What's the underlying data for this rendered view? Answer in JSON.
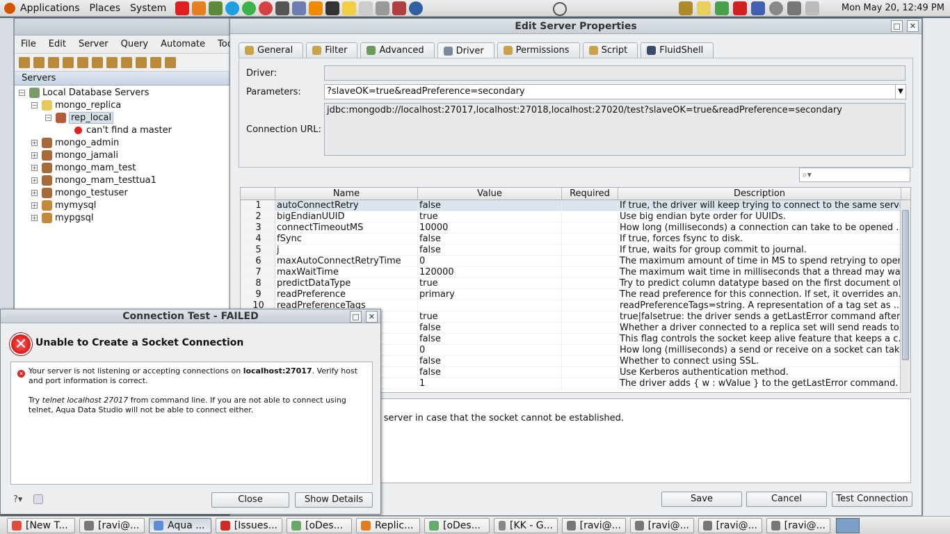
{
  "top_panel": {
    "menus": [
      "Applications",
      "Places",
      "System"
    ],
    "clock": "Mon May 20, 12:49 PM"
  },
  "main_window": {
    "menus": [
      "File",
      "Edit",
      "Server",
      "Query",
      "Automate",
      "Tools"
    ],
    "servers_header": "Servers",
    "tree": {
      "root": "Local Database Servers",
      "group": "mongo_replica",
      "selected": "rep_local",
      "error_node": "can't find a master",
      "servers": [
        "mongo_admin",
        "mongo_jamali",
        "mongo_mam_test",
        "mongo_mam_testtua1",
        "mongo_testuser",
        "mymysql",
        "mypgsql"
      ]
    }
  },
  "dialog": {
    "title": "Edit Server Properties",
    "tabs": [
      "General",
      "Filter",
      "Advanced",
      "Driver",
      "Permissions",
      "Script",
      "FluidShell"
    ],
    "active_tab": "Driver",
    "driver_label": "Driver:",
    "driver_value": "",
    "parameters_label": "Parameters:",
    "parameters_value": "?slaveOK=true&readPreference=secondary",
    "url_label": "Connection URL:",
    "url_value": "jdbc:mongodb://localhost:27017,localhost:27018,localhost:27020/test?slaveOK=true&readPreference=secondary",
    "columns": [
      "",
      "Name",
      "Value",
      "Required",
      "Description"
    ],
    "rows": [
      {
        "n": "1",
        "name": "autoConnectRetry",
        "value": "false",
        "req": "",
        "desc": "If true, the driver will keep trying to connect to the same serve..."
      },
      {
        "n": "2",
        "name": "bigEndianUUID",
        "value": "true",
        "req": "",
        "desc": "Use big endian byte order for UUIDs."
      },
      {
        "n": "3",
        "name": "connectTimeoutMS",
        "value": "10000",
        "req": "",
        "desc": "How long (milliseconds) a connection can take to be opened ..."
      },
      {
        "n": "4",
        "name": "fSync",
        "value": "false",
        "req": "",
        "desc": "If true, forces fsync to disk."
      },
      {
        "n": "5",
        "name": "j",
        "value": "false",
        "req": "",
        "desc": "If true, waits for group commit to journal."
      },
      {
        "n": "6",
        "name": "maxAutoConnectRetryTime",
        "value": "0",
        "req": "",
        "desc": "The maximum amount of time in MS to spend retrying to open ..."
      },
      {
        "n": "7",
        "name": "maxWaitTime",
        "value": "120000",
        "req": "",
        "desc": "The maximum wait time in milliseconds that a thread may wait ..."
      },
      {
        "n": "8",
        "name": "predictDataType",
        "value": "true",
        "req": "",
        "desc": "Try to predict column datatype based on the first document of..."
      },
      {
        "n": "9",
        "name": "readPreference",
        "value": "primary",
        "req": "",
        "desc": "The read preference for this connection. If set, it overrides an..."
      },
      {
        "n": "10",
        "name": "readPreferenceTags",
        "value": "",
        "req": "",
        "desc": "readPreferenceTags=string. A representation of a tag set as ..."
      },
      {
        "n": "",
        "name": "",
        "value": "true",
        "req": "",
        "desc": "true|falsetrue: the driver sends a getLastError command after..."
      },
      {
        "n": "",
        "name": "",
        "value": "false",
        "req": "",
        "desc": "Whether a driver connected to a replica set will send reads to..."
      },
      {
        "n": "",
        "name": "",
        "value": "false",
        "req": "",
        "desc": "This flag controls the socket keep alive feature that keeps a c..."
      },
      {
        "n": "",
        "name": "",
        "value": "0",
        "req": "",
        "desc": "How long (milliseconds) a send or receive on a socket can tak..."
      },
      {
        "n": "",
        "name": "",
        "value": "false",
        "req": "",
        "desc": "Whether to connect using SSL."
      },
      {
        "n": "",
        "name": "",
        "value": "false",
        "req": "",
        "desc": "Use Kerberos authentication method."
      },
      {
        "n": "",
        "name": "",
        "value": "1",
        "req": "",
        "desc": "The driver adds { w : wValue } to the getLastError command. I..."
      }
    ],
    "description_text": "trying to connect to the same server in case that the socket cannot be established.",
    "save": "Save",
    "cancel": "Cancel",
    "test_connection": "Test Connection"
  },
  "conn_test": {
    "title": "Connection Test - FAILED",
    "heading": "Unable to Create a Socket Connection",
    "msg1_pre": "Your server is not listening or accepting connections on ",
    "msg1_host": "localhost",
    "msg1_port": ":27017",
    "msg1_post": ". Verify host and port information is correct.",
    "msg2_pre": "Try ",
    "msg2_cmd": "telnet localhost 27017",
    "msg2_post": " from command line. If you are not able to connect using telnet, Aqua Data Studio will not be able to connect either.",
    "close": "Close",
    "show_details": "Show Details"
  },
  "taskbar": [
    {
      "label": "[New T...",
      "color": "#e14b3b"
    },
    {
      "label": "[ravi@...",
      "color": "#777777"
    },
    {
      "label": "Aqua ...",
      "color": "#5b8ed1"
    },
    {
      "label": "[Issues...",
      "color": "#d02b2b"
    },
    {
      "label": "[oDes...",
      "color": "#6aa86a"
    },
    {
      "label": "Replic...",
      "color": "#e07b1f"
    },
    {
      "label": "[oDes...",
      "color": "#6aa86a"
    },
    {
      "label": "[KK - G...",
      "color": "#888888"
    },
    {
      "label": "[ravi@...",
      "color": "#777777"
    },
    {
      "label": "[ravi@...",
      "color": "#777777"
    },
    {
      "label": "[ravi@...",
      "color": "#777777"
    },
    {
      "label": "[ravi@...",
      "color": "#777777"
    }
  ],
  "colors": {
    "accent": "#c6d4e3",
    "error": "#cc0000",
    "selection": "#dbe4ee"
  }
}
